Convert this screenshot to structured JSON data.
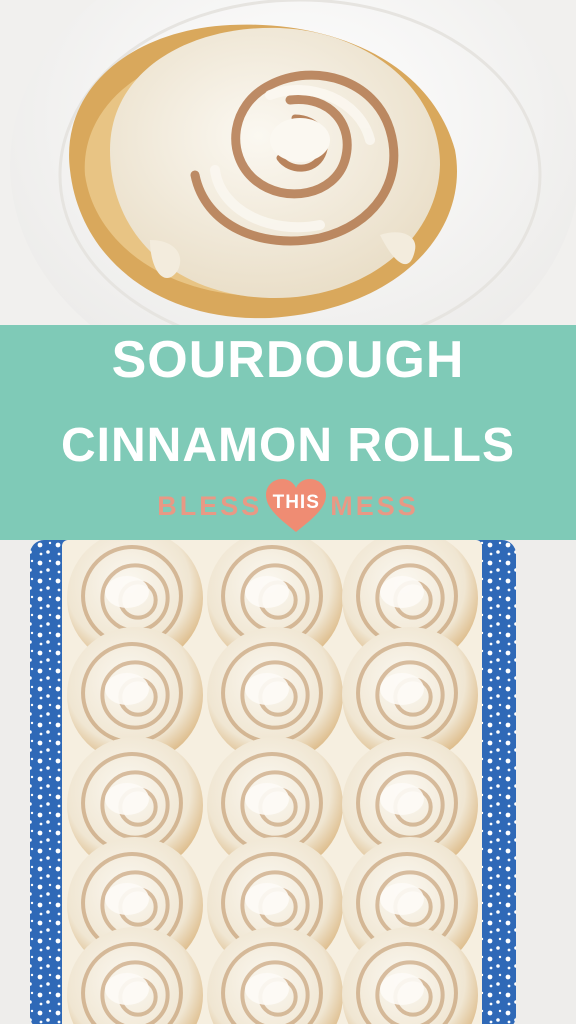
{
  "title": {
    "line1": "SOURDOUGH",
    "line2": "CINNAMON ROLLS"
  },
  "logo": {
    "left_word": "BLESS",
    "heart_word": "THIS",
    "right_word": "MESS"
  },
  "colors": {
    "banner": "#7fcab7",
    "title_text": "#ffffff",
    "logo_text": "#e89985",
    "heart": "#ef8c73",
    "dish_rim": "#2f69b7"
  }
}
